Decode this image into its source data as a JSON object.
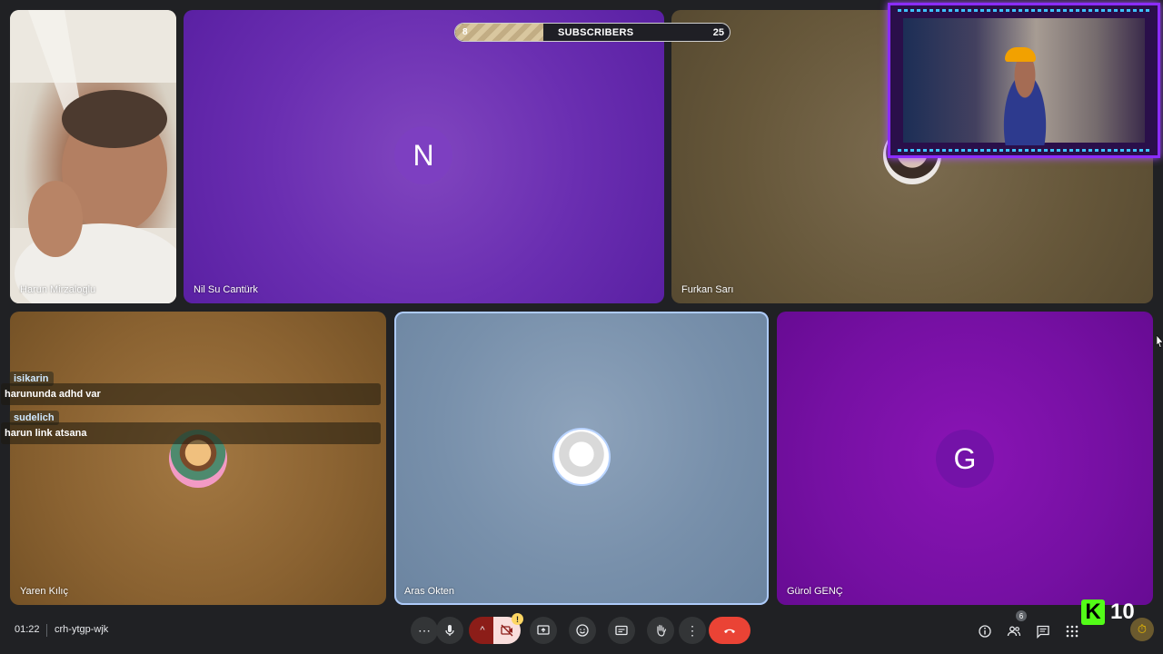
{
  "subscribers": {
    "label": "SUBSCRIBERS",
    "current": "8",
    "goal": "25",
    "progress": 0.32
  },
  "participants": [
    {
      "name": "Harun Mirzaloglu",
      "type": "video"
    },
    {
      "name": "Nil Su Cantürk",
      "type": "letter",
      "initial": "N",
      "avatar_color": "#7d3fc1"
    },
    {
      "name": "Furkan Sarı",
      "type": "photo"
    },
    {
      "name": "Yaren Kılıç",
      "type": "photo"
    },
    {
      "name": "Aras Okten",
      "type": "photo"
    },
    {
      "name": "Gürol GENÇ",
      "type": "letter",
      "initial": "G",
      "avatar_color": "#7412a8"
    }
  ],
  "chat": [
    {
      "user": "isikarin",
      "message": "harununda adhd var"
    },
    {
      "user": "sudelich",
      "message": "harun link atsana"
    }
  ],
  "meeting": {
    "time": "01:22",
    "code": "crh-ytgp-wjk"
  },
  "controls": [
    {
      "name": "more-options-icon",
      "symbol": "⋯"
    },
    {
      "name": "microphone-icon"
    },
    {
      "name": "camera-options-chevron-icon",
      "symbol": "^"
    },
    {
      "name": "camera-off-icon"
    },
    {
      "name": "present-screen-icon"
    },
    {
      "name": "emoji-reaction-icon"
    },
    {
      "name": "captions-icon"
    },
    {
      "name": "raise-hand-icon"
    },
    {
      "name": "more-vert-icon",
      "symbol": "⋮"
    },
    {
      "name": "hang-up-icon"
    }
  ],
  "camera_warning": "!",
  "people_count": "6",
  "kick": {
    "logo": "K",
    "count": "10"
  },
  "colors": {
    "accent_blue": "#aecbfa",
    "hangup_red": "#ea4335",
    "kick_green": "#53fc18",
    "overlay_purple": "#8b2cff"
  }
}
